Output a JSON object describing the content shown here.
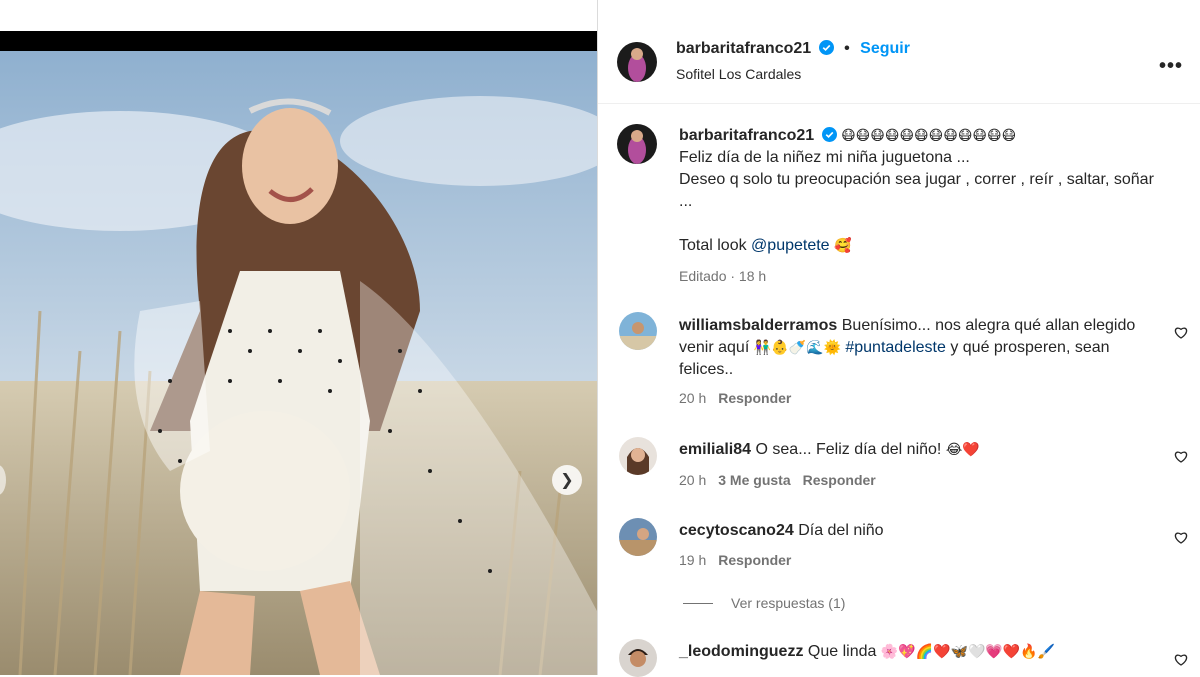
{
  "post": {
    "author": "barbaritafranco21",
    "follow_label": "Seguir",
    "dot": "•",
    "location": "Sofitel Los Cardales",
    "more": "•••"
  },
  "caption": {
    "author": "barbaritafranco21",
    "emojis": "😷😷😷😷😷😷😷😷😷😷😷😷",
    "line1": "Feliz día de la niñez mi niña juguetona ...",
    "line2": "Deseo q solo tu preocupación sea jugar , correr , reír , saltar, soñar ...",
    "look_prefix": "Total look ",
    "look_mention": "@pupetete",
    "look_emoji": "🥰",
    "edited": "Editado · 18 h"
  },
  "comments": [
    {
      "user": "williamsbalderramos",
      "text_a": "Buenísimo... nos alegra qué allan elegido venir aquí ",
      "emojis_a": "👫👶🍼🌊🌞",
      "hashtag": "#puntadeleste",
      "text_b": " y qué prosperen, sean felices..",
      "time": "20 h",
      "reply": "Responder"
    },
    {
      "user": "emiliali84",
      "text": "O sea... Feliz día del niño! ",
      "emojis": "😂❤️",
      "time": "20 h",
      "likes": "3 Me gusta",
      "reply": "Responder"
    },
    {
      "user": "cecytoscano24",
      "text": "Día del niño",
      "time": "19 h",
      "reply": "Responder"
    },
    {
      "user": "_leodominguezz",
      "text": "Que linda ",
      "emojis": "🌸💖🌈❤️🦋🤍💗❤️🔥🖌️"
    }
  ],
  "view_replies": "Ver respuestas (1)",
  "colors": {
    "link": "#0095f6",
    "mention": "#00376b",
    "muted": "#737373",
    "verified": "#0095f6"
  }
}
